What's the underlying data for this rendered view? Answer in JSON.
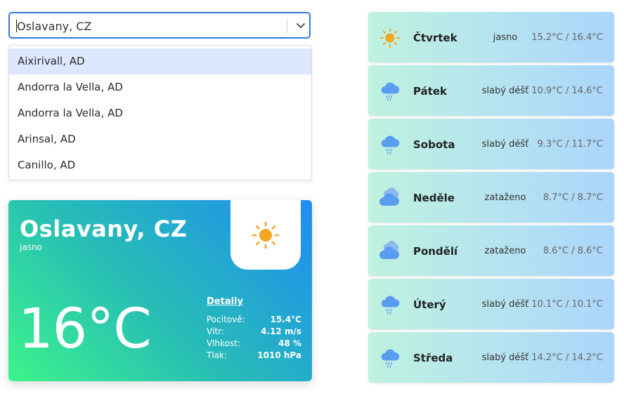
{
  "search": {
    "value": "Oslavany, CZ",
    "options": [
      "Aixirivall, AD",
      "Andorra la Vella, AD",
      "Andorra la Vella, AD",
      "Arinsal, AD",
      "Canillo, AD"
    ]
  },
  "current": {
    "city": "Oslavany, CZ",
    "description": "jasno",
    "icon": "sun-icon",
    "temperature": "16°C",
    "details_title": "Detaily",
    "details": [
      {
        "label": "Pocitově:",
        "value": "15.4°C"
      },
      {
        "label": "Vítr:",
        "value": "4.12 m/s"
      },
      {
        "label": "Vlhkost:",
        "value": "48 %"
      },
      {
        "label": "Tlak:",
        "value": "1010 hPa"
      }
    ]
  },
  "forecast": [
    {
      "day": "Čtvrtek",
      "description": "jasno",
      "temps": "15.2°C / 16.4°C",
      "icon": "sun-icon"
    },
    {
      "day": "Pátek",
      "description": "slabý déšť",
      "temps": "10.9°C / 14.6°C",
      "icon": "rain-cloud-icon"
    },
    {
      "day": "Sobota",
      "description": "slabý déšť",
      "temps": "9.3°C / 11.7°C",
      "icon": "rain-cloud-icon"
    },
    {
      "day": "Neděle",
      "description": "zataženo",
      "temps": "8.7°C / 8.7°C",
      "icon": "overcast-cloud-icon"
    },
    {
      "day": "Pondělí",
      "description": "zataženo",
      "temps": "8.6°C / 8.6°C",
      "icon": "overcast-cloud-icon"
    },
    {
      "day": "Úterý",
      "description": "slabý déšť",
      "temps": "10.1°C / 10.1°C",
      "icon": "rain-cloud-icon"
    },
    {
      "day": "Středa",
      "description": "slabý déšť",
      "temps": "14.2°C / 14.2°C",
      "icon": "rain-cloud-icon"
    }
  ],
  "colors": {
    "accent": "#2f7ad8",
    "card_gradient_start": "#3df48a",
    "card_gradient_end": "#1f8cf3",
    "sun": "#f5a623"
  }
}
